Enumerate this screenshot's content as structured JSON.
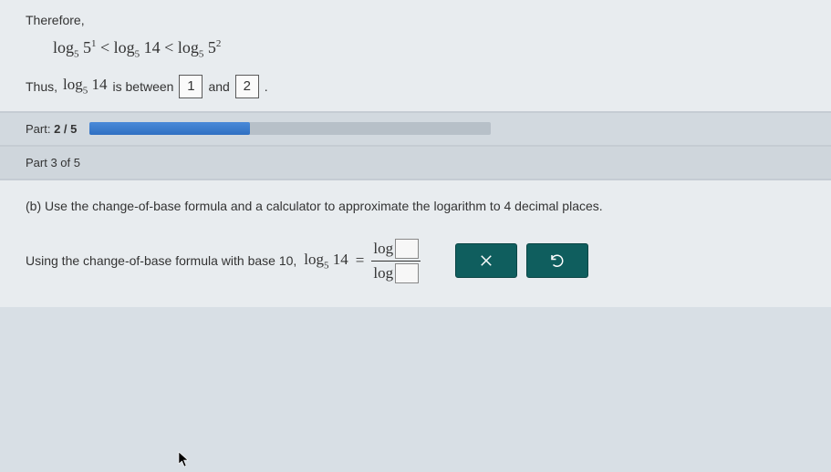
{
  "section1": {
    "therefore": "Therefore,",
    "inequality_html": "log<span class='sub'>5</span> 5<span class='sup'>1</span> &lt; log<span class='sub'>5</span> 14 &lt; log<span class='sub'>5</span> 5<span class='sup'>2</span>",
    "thus_prefix": "Thus,",
    "thus_math": "log<span class='sub'>5</span> 14",
    "thus_middle": "is between",
    "box1": "1",
    "and": "and",
    "box2": "2",
    "period": "."
  },
  "progress": {
    "label_prefix": "Part:",
    "label_value": "2 / 5",
    "percent": 40
  },
  "part_header": "Part 3 of 5",
  "question": {
    "prompt": "(b) Use the change-of-base formula and a calculator to approximate the logarithm to 4 decimal places.",
    "lead": "Using the change-of-base formula with base 10,",
    "lhs": "log<span class='sub'>5</span> 14",
    "equals": "=",
    "num_label": "log",
    "den_label": "log"
  },
  "buttons": {
    "clear": "×",
    "reset": "↺"
  }
}
